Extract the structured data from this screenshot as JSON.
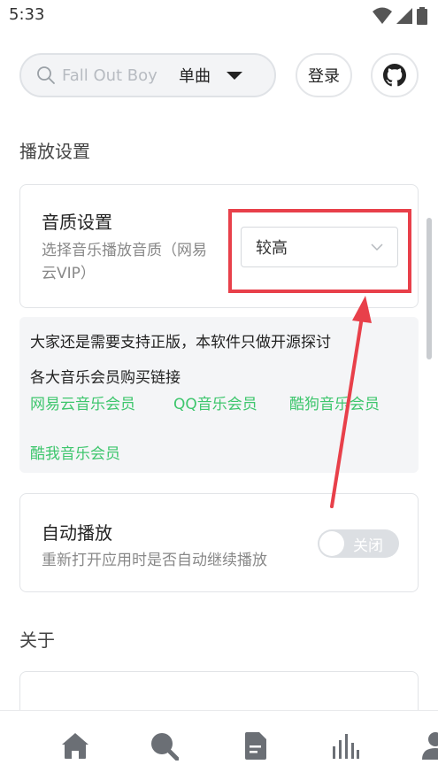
{
  "status_bar": {
    "time": "5:33"
  },
  "search": {
    "placeholder": "Fall Out Boy",
    "type_selected": "单曲"
  },
  "header": {
    "login_label": "登录"
  },
  "playback_settings": {
    "section_title": "播放设置",
    "quality": {
      "title": "音质设置",
      "description_line1": "选择音乐播放音质（网易",
      "description_line2": "云VIP）",
      "selected_value": "较高"
    },
    "info": {
      "line1": "大家还是需要支持正版，本软件只做开源探讨",
      "line2": "各大音乐会员购买链接",
      "links": [
        "网易云音乐会员",
        "QQ音乐会员",
        "酷狗音乐会员",
        "酷我音乐会员"
      ]
    },
    "autoplay": {
      "title": "自动播放",
      "description": "重新打开应用时是否自动继续播放",
      "toggle_label": "关闭"
    }
  },
  "about": {
    "section_title": "关于"
  },
  "colors": {
    "accent_green": "#3ec66d",
    "highlight_red": "#e8404a",
    "icon_gray": "#6b6f75"
  },
  "bottom_nav": {
    "icons": [
      "home-icon",
      "search-icon",
      "document-icon",
      "chart-icon",
      "user-icon"
    ]
  }
}
